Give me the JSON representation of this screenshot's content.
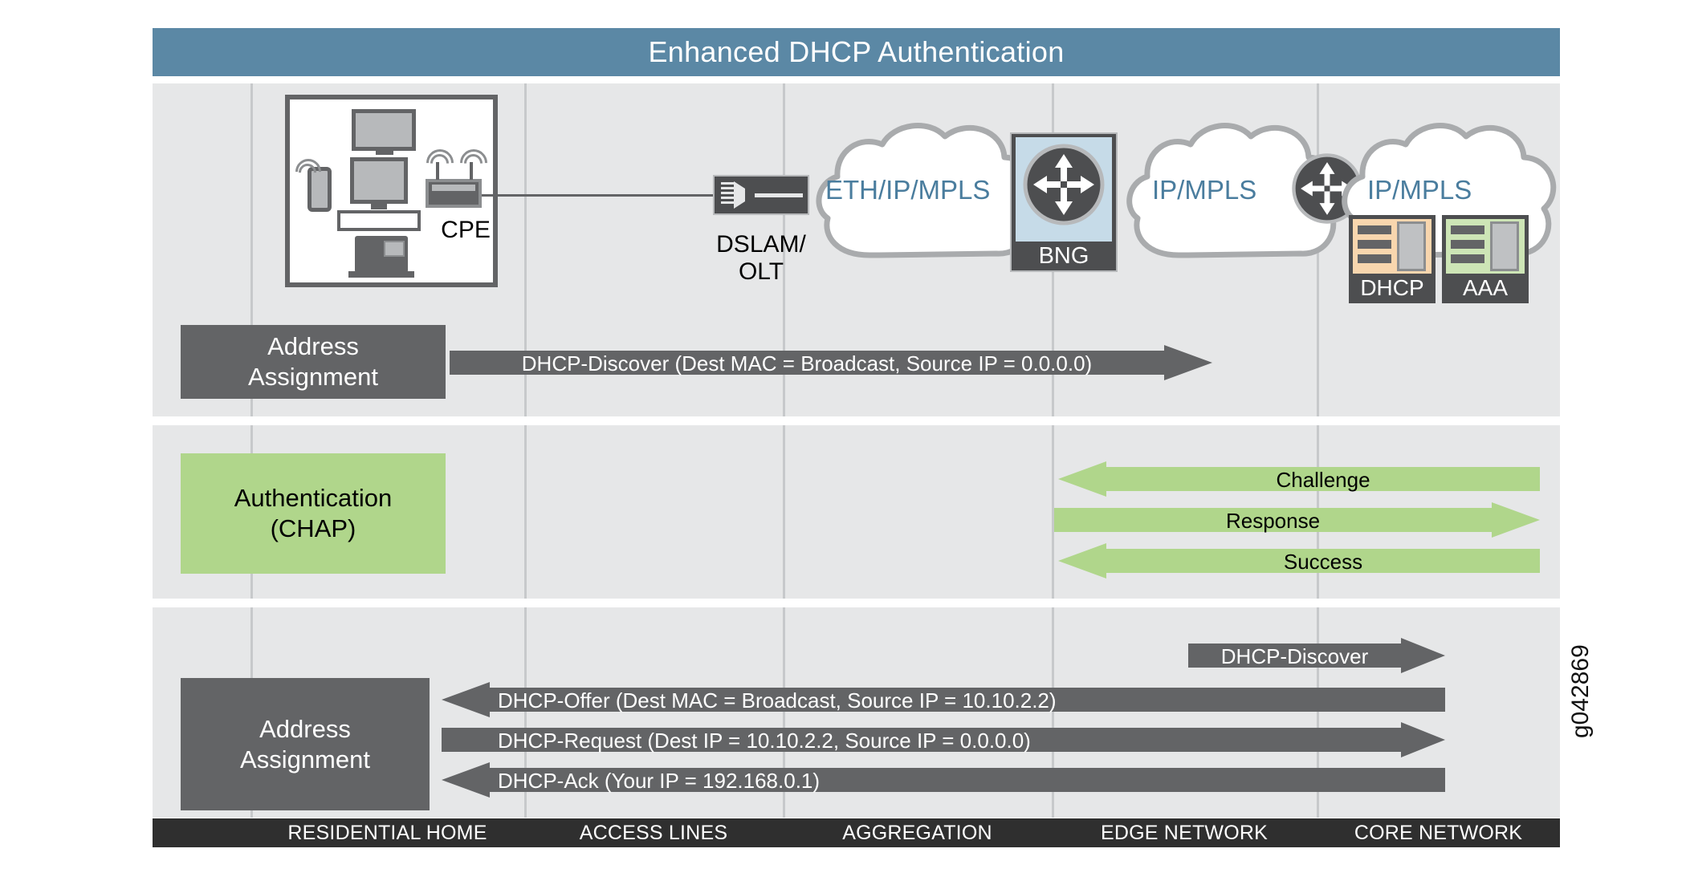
{
  "title": "Enhanced DHCP Authentication",
  "watermark": "g042869",
  "colors": {
    "header_blue": "#5b88a5",
    "band_gray": "#e6e7e8",
    "dark_gray": "#636466",
    "green": "#b0d68b",
    "cloud_text_blue": "#4a7d9e",
    "footer_black": "#2f2f2f",
    "bng_blue": "#c6dbe8",
    "dhcp_peach": "#f8d6ae",
    "aaa_green": "#cde5b6"
  },
  "topology": {
    "cpe_label": "CPE",
    "dslam_label": "DSLAM/\nOLT",
    "bng_label": "BNG",
    "clouds": [
      {
        "label": "ETH/IP/MPLS"
      },
      {
        "label": "IP/MPLS"
      },
      {
        "label": "IP/MPLS"
      }
    ],
    "servers": [
      {
        "label": "DHCP",
        "color": "#f8d6ae"
      },
      {
        "label": "AAA",
        "color": "#cde5b6"
      }
    ],
    "home_devices": [
      "tv-icon",
      "monitor-icon",
      "keyboard-icon",
      "mobile-phone-icon",
      "voip-phone-icon",
      "wifi-router-icon"
    ]
  },
  "sections": [
    {
      "name": "address-assignment-discover",
      "block_label": "Address\nAssignment",
      "block_style": "gray",
      "messages": [
        {
          "text": "DHCP-Discover (Dest MAC = Broadcast, Source IP = 0.0.0.0)",
          "direction": "right",
          "color": "gray"
        }
      ]
    },
    {
      "name": "authentication-chap",
      "block_label": "Authentication\n(CHAP)",
      "block_style": "green",
      "messages": [
        {
          "text": "Challenge",
          "direction": "left",
          "color": "green"
        },
        {
          "text": "Response",
          "direction": "right",
          "color": "green"
        },
        {
          "text": "Success",
          "direction": "left",
          "color": "green"
        }
      ]
    },
    {
      "name": "address-assignment-offer",
      "block_label": "Address\nAssignment",
      "block_style": "gray",
      "messages": [
        {
          "text": "DHCP-Discover",
          "direction": "right",
          "color": "gray"
        },
        {
          "text": "DHCP-Offer (Dest MAC = Broadcast, Source IP = 10.10.2.2)",
          "direction": "left",
          "color": "gray"
        },
        {
          "text": "DHCP-Request (Dest IP = 10.10.2.2, Source IP = 0.0.0.0)",
          "direction": "right",
          "color": "gray"
        },
        {
          "text": "DHCP-Ack (Your IP = 192.168.0.1)",
          "direction": "left",
          "color": "gray"
        }
      ]
    }
  ],
  "footer": {
    "zones": [
      "RESIDENTIAL HOME",
      "ACCESS LINES",
      "AGGREGATION",
      "EDGE NETWORK",
      "CORE NETWORK"
    ]
  }
}
